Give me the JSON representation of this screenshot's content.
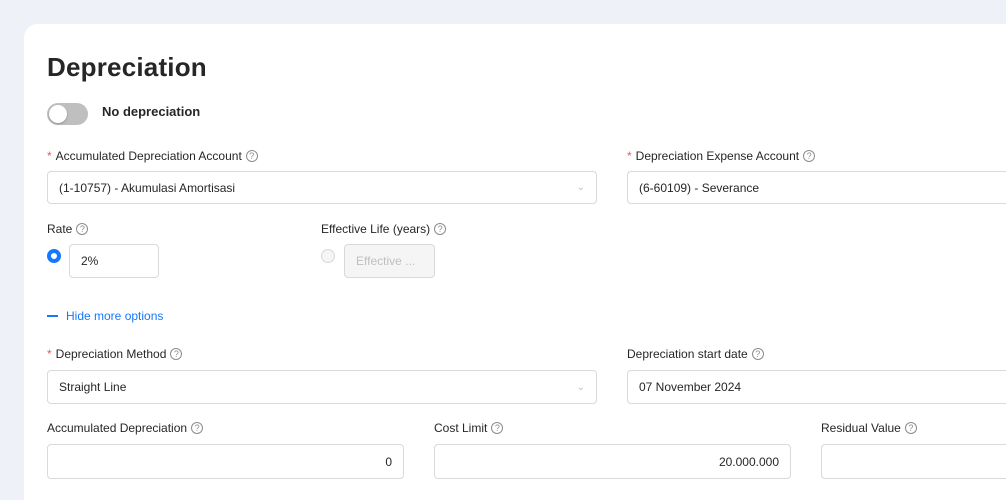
{
  "section": {
    "title": "Depreciation"
  },
  "toggle": {
    "label": "No depreciation"
  },
  "accumulated_account": {
    "label": "Accumulated Depreciation Account",
    "value": "(1-10757) - Akumulasi Amortisasi"
  },
  "expense_account": {
    "label": "Depreciation Expense Account",
    "value": "(6-60109) - Severance"
  },
  "rate": {
    "label": "Rate",
    "value": "2%"
  },
  "effective_life": {
    "label": "Effective Life (years)",
    "placeholder": "Effective ..."
  },
  "more_options": {
    "label": "Hide more options"
  },
  "method": {
    "label": "Depreciation Method",
    "value": "Straight Line"
  },
  "start_date": {
    "label": "Depreciation start date",
    "value": "07 November 2024"
  },
  "accumulated_depreciation": {
    "label": "Accumulated Depreciation",
    "value": "0"
  },
  "cost_limit": {
    "label": "Cost Limit",
    "value": "20.000.000"
  },
  "residual_value": {
    "label": "Residual Value",
    "value": ""
  },
  "icons": {
    "help": "question-circle-icon",
    "chevron": "chevron-down-icon"
  },
  "colors": {
    "primary": "#1677ff",
    "required": "#ff4d4f",
    "background": "#eef1f7"
  }
}
